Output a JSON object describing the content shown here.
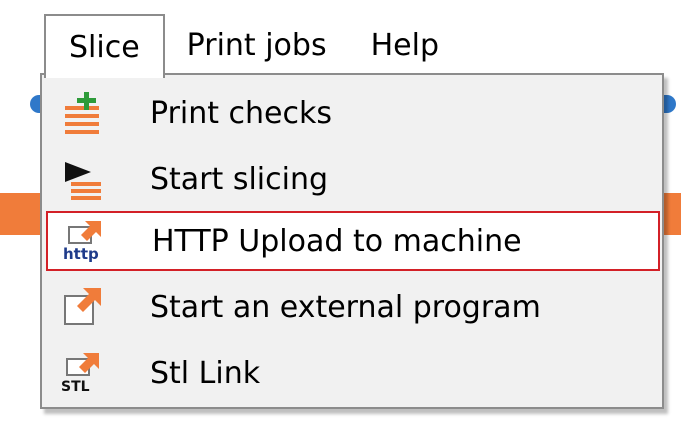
{
  "menubar": {
    "items": [
      {
        "label": "Slice",
        "active": true
      },
      {
        "label": "Print jobs"
      },
      {
        "label": "Help"
      }
    ]
  },
  "dropdown": {
    "items": [
      {
        "label": "Print checks",
        "icon": "print-checks-icon"
      },
      {
        "label": "Start slicing",
        "icon": "start-slicing-icon"
      },
      {
        "label": "HTTP Upload to machine",
        "icon": "http-upload-icon",
        "icon_text": "http",
        "highlighted": true
      },
      {
        "label": "Start an external program",
        "icon": "external-program-icon"
      },
      {
        "label": "Stl Link",
        "icon": "stl-link-icon",
        "icon_text": "STL"
      }
    ]
  },
  "colors": {
    "highlight_border": "#d32027",
    "menu_background": "#f1f1f1",
    "icon_orange": "#f07c3a",
    "icon_green": "#2e9b3a",
    "icon_blue_text": "#1f3b8a",
    "background_strip": "#f07c3a"
  }
}
